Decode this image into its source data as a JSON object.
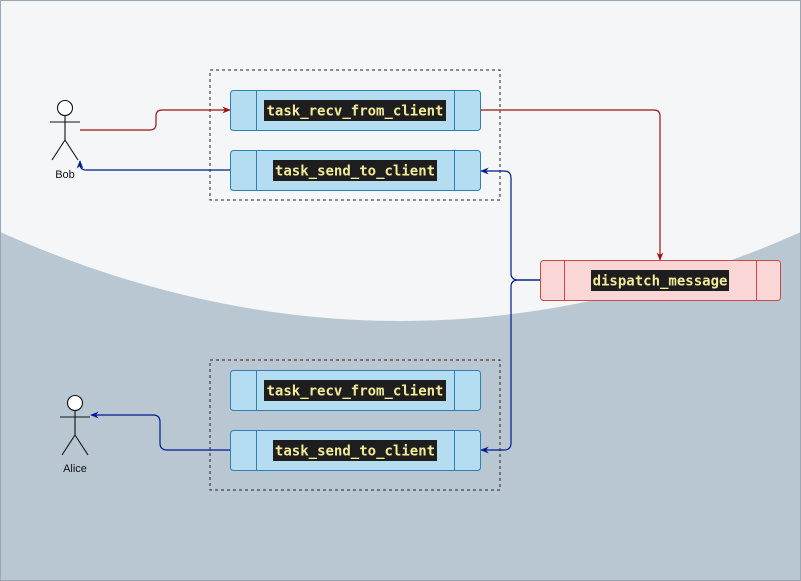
{
  "colors": {
    "bg_top": "#f5f6f7",
    "bg_bottom": "#b9c7d3",
    "process_fill": "#b5ddf2",
    "process_stroke": "#2e7fb3",
    "dispatch_fill": "#fad6d6",
    "dispatch_stroke": "#c94a4a",
    "label_bg": "#1e1e1e",
    "label_text": "#f3ea9a",
    "arrow_red": "#a01212",
    "arrow_blue": "#001a8f",
    "group_border": "#222222"
  },
  "actors": {
    "bob": {
      "label": "Bob"
    },
    "alice": {
      "label": "Alice"
    }
  },
  "bob_group": {
    "recv": {
      "label": "task_recv_from_client"
    },
    "send": {
      "label": "task_send_to_client"
    }
  },
  "alice_group": {
    "recv": {
      "label": "task_recv_from_client"
    },
    "send": {
      "label": "task_send_to_client"
    }
  },
  "dispatch": {
    "label": "dispatch_message"
  }
}
